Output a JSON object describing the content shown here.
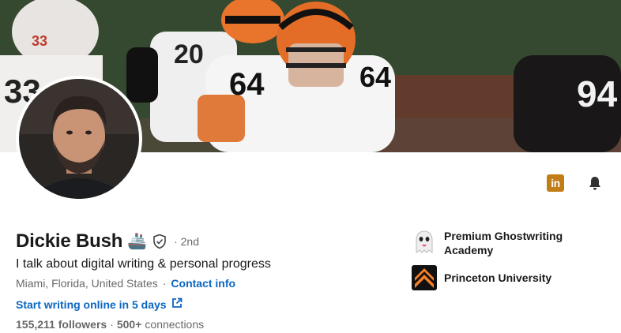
{
  "profile": {
    "name": "Dickie Bush",
    "name_emoji": "🚢",
    "degree": "· 2nd",
    "headline": "I talk about digital writing & personal progress",
    "location": "Miami, Florida, United States",
    "contact_label": "Contact info",
    "custom_link": "Start writing online in 5 days",
    "followers": "155,211 followers",
    "connections": "500+",
    "connections_suffix": "connections"
  },
  "companies": [
    {
      "name": "Premium Ghostwriting Academy",
      "icon": "ghost-emoji-logo"
    },
    {
      "name": "Princeton University",
      "icon": "princeton-chevron-logo"
    }
  ],
  "actions": {
    "linkedin_badge": "in",
    "bell": "bell-icon"
  },
  "colors": {
    "link_blue": "#0a66c2",
    "linkedin_badge": "#c37d16",
    "princeton_orange": "#f58025"
  }
}
